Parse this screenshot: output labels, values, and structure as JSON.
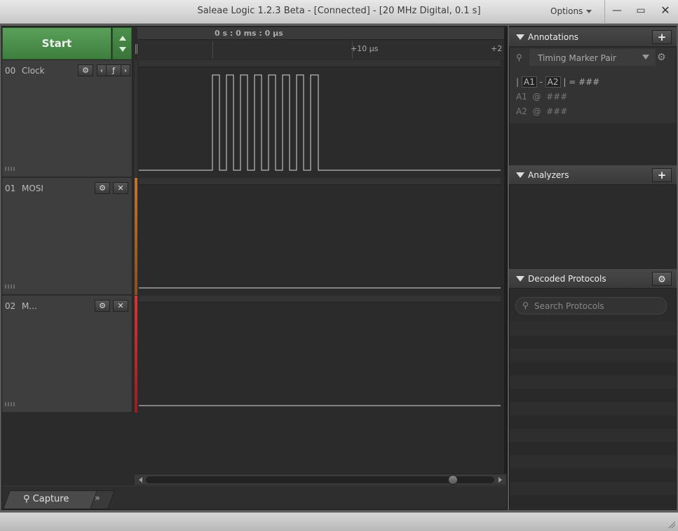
{
  "window": {
    "title": "Saleae Logic 1.2.3 Beta - [Connected] - [20 MHz Digital, 0.1 s]",
    "options_label": "Options",
    "minimize": "—",
    "maximize": "▭",
    "close": "✕"
  },
  "capture": {
    "start_label": "Start"
  },
  "ruler": {
    "origin_label": "0 s : 0 ms : 0 µs",
    "tick_1": "+10 µs",
    "tick_2": "+2"
  },
  "channels": [
    {
      "num": "00",
      "name": "Clock",
      "color": "#3a3a3a"
    },
    {
      "num": "01",
      "name": "MOSI",
      "color": "#b26a2c"
    },
    {
      "num": "02",
      "name": "M...",
      "color": "#cc2f2f"
    }
  ],
  "tabs": {
    "capture_label": "Capture",
    "more_label": "»"
  },
  "annotations": {
    "title": "Annotations",
    "add_button": "+",
    "marker_type": "Timing Marker Pair",
    "marker_diff_a": "A1",
    "marker_diff_b": "A2",
    "marker_diff_value": "###",
    "a1_label": "A1",
    "a1_value": "###",
    "a2_label": "A2",
    "a2_value": "###"
  },
  "analyzers": {
    "title": "Analyzers",
    "add_button": "+"
  },
  "decoded": {
    "title": "Decoded Protocols",
    "search_placeholder": "Search Protocols"
  },
  "colors": {
    "start_green": "#4a8f4a",
    "panel_bg": "#2b2b2b",
    "waveform": "#d9d9d9"
  }
}
